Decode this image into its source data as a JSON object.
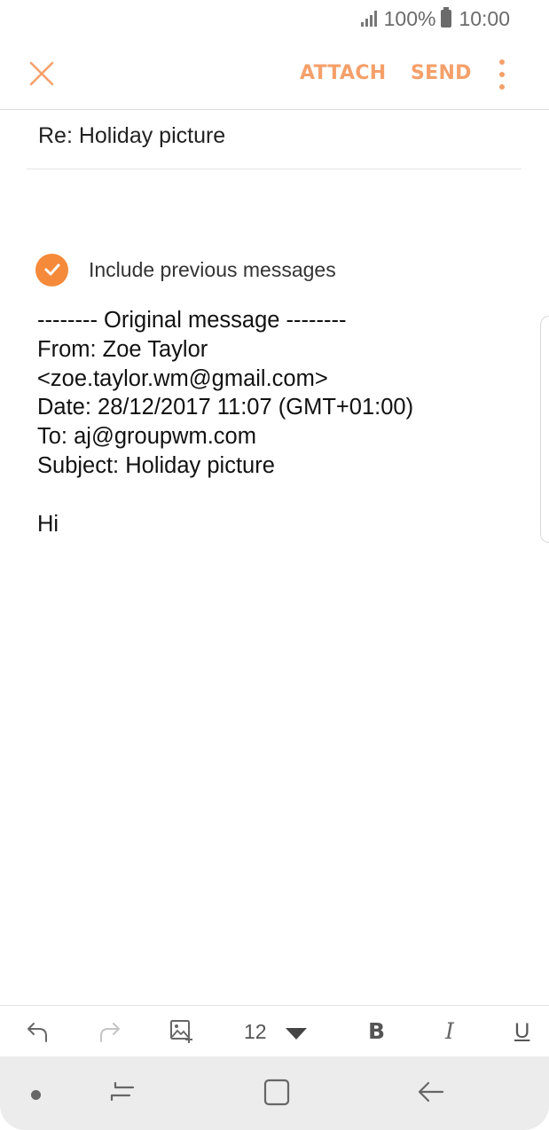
{
  "status_bar": {
    "battery_percent": "100%",
    "time": "10:00"
  },
  "action_bar": {
    "attach_label": "ATTACH",
    "send_label": "SEND",
    "accent_color": "#f5a06a"
  },
  "compose": {
    "subject": "Re: Holiday picture",
    "include_previous": {
      "label": "Include previous messages",
      "checked": true
    },
    "body_lines": [
      "-------- Original message --------",
      "From: Zoe Taylor",
      "<zoe.taylor.wm@gmail.com>",
      "Date: 28/12/2017 11:07 (GMT+01:00)",
      "To: aj@groupwm.com",
      "Subject: Holiday picture",
      "",
      "Hi"
    ]
  },
  "format_toolbar": {
    "font_size": "12",
    "bold_label": "B",
    "italic_label": "I",
    "underline_label": "U"
  },
  "icons": {
    "close": "close-icon",
    "more": "more-vert-icon",
    "undo": "undo-icon",
    "redo": "redo-icon",
    "insert_image": "insert-image-icon",
    "nav_recent": "recent-apps-icon",
    "nav_home": "home-icon",
    "nav_back": "back-icon"
  }
}
